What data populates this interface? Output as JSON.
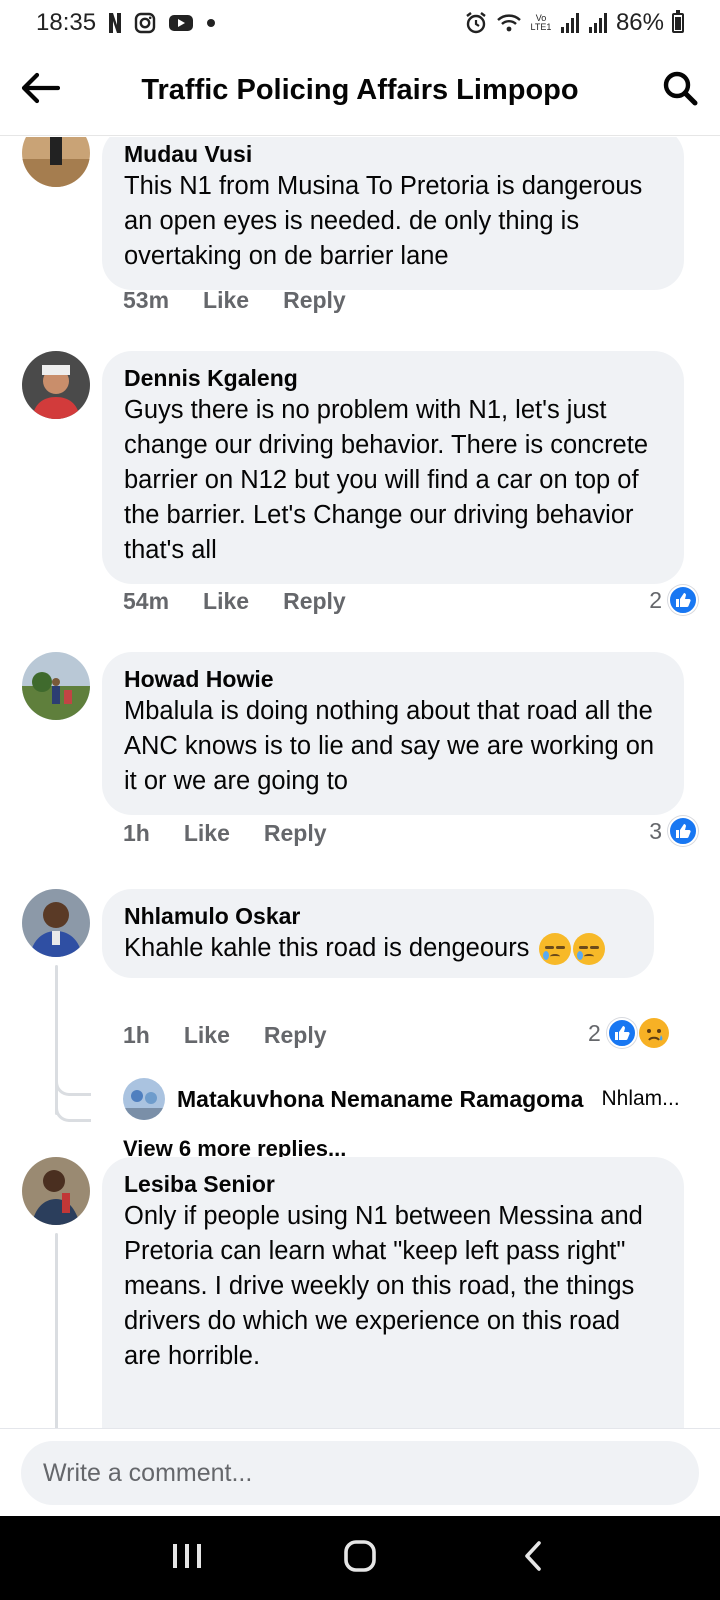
{
  "status_bar": {
    "time": "18:35",
    "battery_percent": "86%",
    "left_icons": [
      "netflix-icon",
      "instagram-icon",
      "youtube-icon",
      "dot-icon"
    ],
    "right_icons": [
      "alarm-icon",
      "wifi-icon",
      "volte-icon",
      "signal-icon",
      "signal-icon",
      "battery-icon"
    ],
    "volte_label": "Vo LTE1"
  },
  "header": {
    "title": "Traffic Policing Affairs Limpopo",
    "back_icon": "arrow-left-icon",
    "search_icon": "search-icon"
  },
  "comments": [
    {
      "author": "Mudau Vusi",
      "text": "This N1 from Musina To Pretoria  is dangerous an open eyes is needed. de only thing is overtaking on de barrier lane",
      "time": "53m",
      "like_label": "Like",
      "reply_label": "Reply",
      "reaction_count": ""
    },
    {
      "author": "Dennis Kgaleng",
      "text": "Guys there is no problem with N1, let's  just change our driving behavior. There is concrete barrier on N12 but  you will find a car on top of the barrier. Let's Change our driving behavior that's all",
      "time": "54m",
      "like_label": "Like",
      "reply_label": "Reply",
      "reaction_count": "2"
    },
    {
      "author": "Howad Howie",
      "text": "Mbalula is doing nothing about that road all the ANC knows is to lie and say we are working on it or we are going to",
      "time": "1h",
      "like_label": "Like",
      "reply_label": "Reply",
      "reaction_count": "3"
    },
    {
      "author": "Nhlamulo Oskar",
      "text": "Khahle kahle this road is dengeours",
      "time": "1h",
      "like_label": "Like",
      "reply_label": "Reply",
      "reaction_count": "2",
      "reply_preview": {
        "author": "Matakuvhona Nemaname Ramagoma",
        "snippet": "Nhlam..."
      },
      "view_more": "View 6 more replies..."
    },
    {
      "author": "Lesiba Senior",
      "text": "Only if people using N1 between Messina and Pretoria can learn what \"keep left pass right\" means. I drive weekly on this road, the things drivers do which we experience on this road are horrible."
    }
  ],
  "composer": {
    "placeholder": "Write a comment..."
  },
  "nav_bar": {
    "icons": [
      "recent-apps-icon",
      "home-icon",
      "back-icon"
    ]
  },
  "colors": {
    "bubble": "#f0f2f5",
    "like_blue": "#1877f2",
    "secondary_text": "#65676b"
  }
}
